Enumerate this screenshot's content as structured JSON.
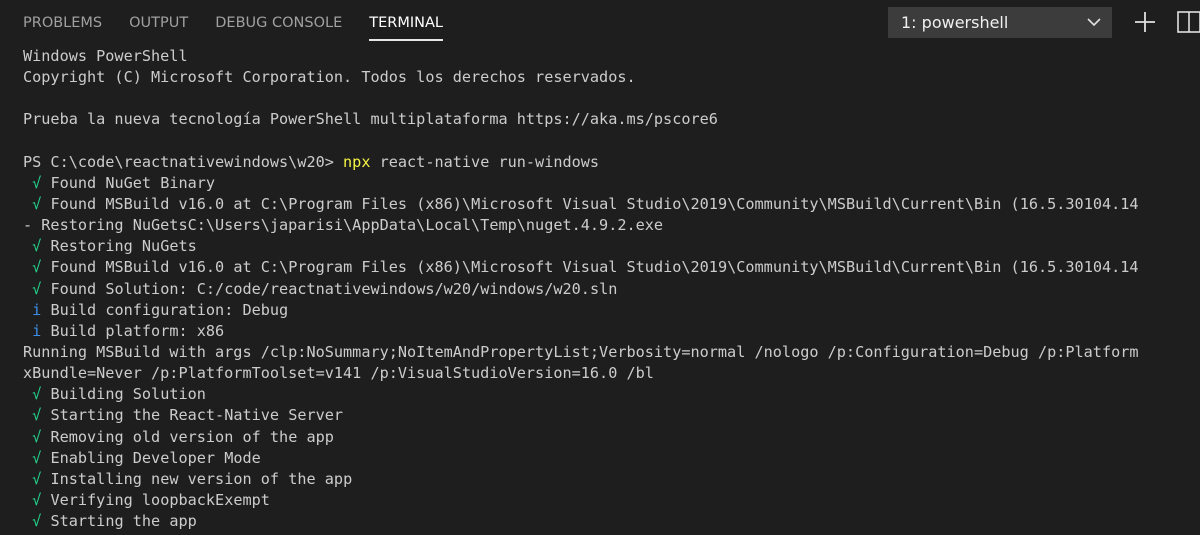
{
  "tabs": [
    {
      "label": "PROBLEMS",
      "active": false
    },
    {
      "label": "OUTPUT",
      "active": false
    },
    {
      "label": "DEBUG CONSOLE",
      "active": false
    },
    {
      "label": "TERMINAL",
      "active": true
    }
  ],
  "terminal_select": {
    "value": "1: powershell"
  },
  "icons": {
    "chevron": "chevron-down-icon",
    "new_terminal": "plus-icon",
    "split": "split-icon"
  },
  "colors": {
    "background": "#1e1e1e",
    "text": "#cccccc",
    "check": "#23d18b",
    "info": "#3b8eea",
    "command": "#f5f543"
  },
  "terminal": {
    "lines": [
      {
        "text": "Windows PowerShell"
      },
      {
        "text": "Copyright (C) Microsoft Corporation. Todos los derechos reservados."
      },
      {
        "text": ""
      },
      {
        "text": "Prueba la nueva tecnología PowerShell multiplataforma https://aka.ms/pscore6"
      },
      {
        "text": ""
      },
      {
        "prompt": "PS C:\\code\\reactnativewindows\\w20> ",
        "cmd": "npx",
        "args": " react-native run-windows"
      },
      {
        "marker": "√",
        "text": "Found NuGet Binary"
      },
      {
        "marker": "√",
        "text": "Found MSBuild v16.0 at C:\\Program Files (x86)\\Microsoft Visual Studio\\2019\\Community\\MSBuild\\Current\\Bin (16.5.30104.14"
      },
      {
        "text": "- Restoring NuGetsC:\\Users\\japarisi\\AppData\\Local\\Temp\\nuget.4.9.2.exe"
      },
      {
        "marker": "√",
        "text": "Restoring NuGets"
      },
      {
        "marker": "√",
        "text": "Found MSBuild v16.0 at C:\\Program Files (x86)\\Microsoft Visual Studio\\2019\\Community\\MSBuild\\Current\\Bin (16.5.30104.14"
      },
      {
        "marker": "√",
        "text": "Found Solution: C:/code/reactnativewindows/w20/windows/w20.sln"
      },
      {
        "marker": "i",
        "text": "Build configuration: Debug"
      },
      {
        "marker": "i",
        "text": "Build platform: x86"
      },
      {
        "text": "Running MSBuild with args /clp:NoSummary;NoItemAndPropertyList;Verbosity=normal /nologo /p:Configuration=Debug /p:Platform"
      },
      {
        "text": "xBundle=Never /p:PlatformToolset=v141 /p:VisualStudioVersion=16.0 /bl"
      },
      {
        "marker": "√",
        "text": "Building Solution"
      },
      {
        "marker": "√",
        "text": "Starting the React-Native Server"
      },
      {
        "marker": "√",
        "text": "Removing old version of the app"
      },
      {
        "marker": "√",
        "text": "Enabling Developer Mode"
      },
      {
        "marker": "√",
        "text": "Installing new version of the app"
      },
      {
        "marker": "√",
        "text": "Verifying loopbackExempt"
      },
      {
        "marker": "√",
        "text": "Starting the app"
      }
    ]
  }
}
